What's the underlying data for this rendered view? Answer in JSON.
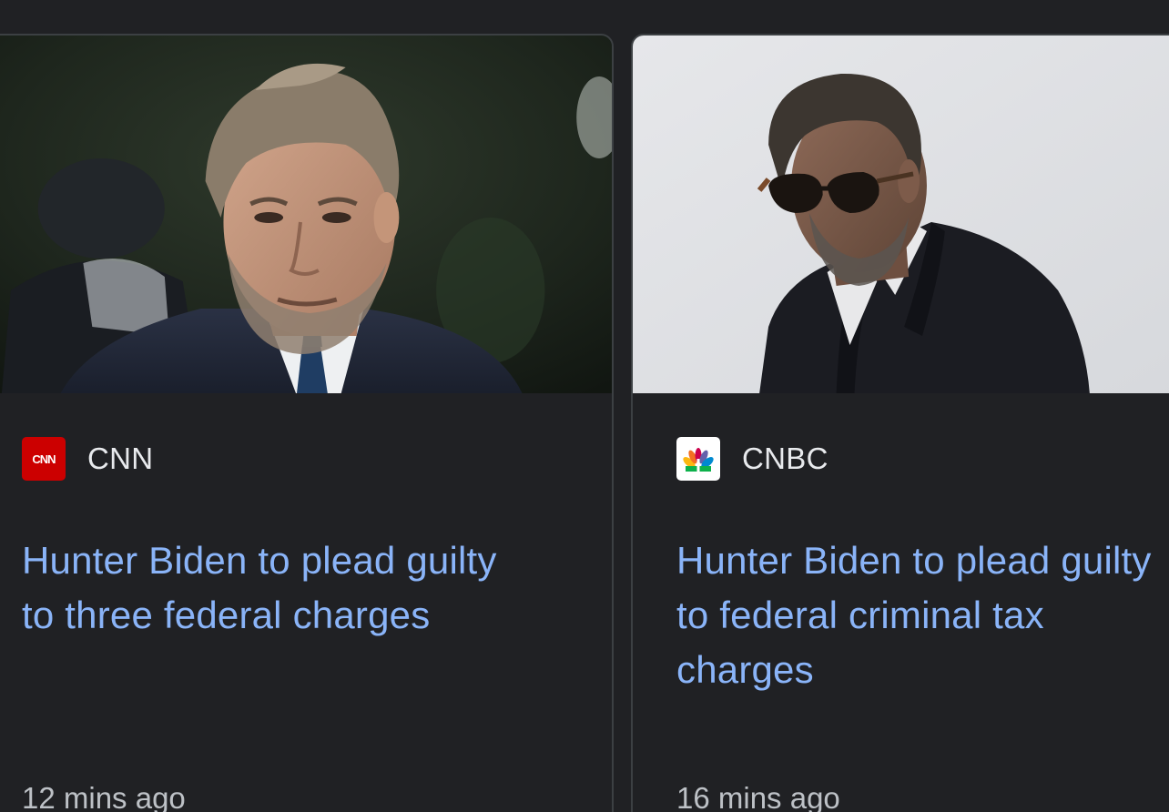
{
  "cards": [
    {
      "source": "CNN",
      "logo_text": "CNN",
      "logo_color": "#cc0000",
      "headline": "Hunter Biden to plead guilty\nto three federal charges",
      "time": "12 mins ago",
      "image": "news-photo-man-grey-hair-dark-suit-blue-tie"
    },
    {
      "source": "CNBC",
      "logo_color": "#ffffff",
      "logo_icon": "cnbc-peacock-icon",
      "headline": "Hunter Biden to plead guilty\nto federal criminal tax\ncharges",
      "time": "16 mins ago",
      "image": "news-photo-man-sunglasses-dark-coat"
    }
  ],
  "colors": {
    "background": "#202124",
    "card_border": "#3c4043",
    "headline": "#8ab4f8",
    "source_text": "#e8eaed",
    "time_text": "#bdc1c6"
  }
}
